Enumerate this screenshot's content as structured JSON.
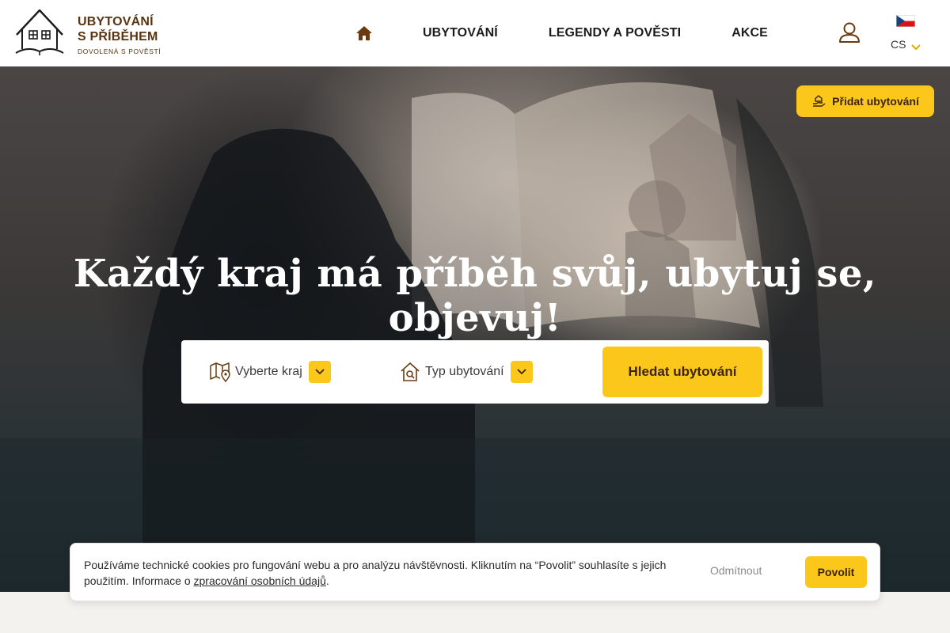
{
  "header": {
    "logo": {
      "line1": "UBYTOVÁNÍ",
      "line2": "S PŘÍBĚHEM",
      "tagline": "DOVOLENÁ S POVĚSTÍ",
      "icon": "house-logo-icon"
    },
    "nav": {
      "home_icon": "home-icon",
      "items": [
        {
          "label": "UBYTOVÁNÍ"
        },
        {
          "label": "LEGENDY A POVĚSTI"
        },
        {
          "label": "AKCE"
        }
      ]
    },
    "user_icon": "user-icon",
    "language": {
      "code": "CS",
      "flag": "czech-flag-icon"
    }
  },
  "hero": {
    "add_button": {
      "label": "Přidat ubytování",
      "icon": "add-accommodation-icon"
    },
    "headline": "Každý kraj má příběh svůj, ubytuj se, objevuj!",
    "search": {
      "region": {
        "label": "Vyberte kraj",
        "icon": "map-pin-icon"
      },
      "type": {
        "label": "Typ ubytování",
        "icon": "house-search-icon"
      },
      "submit_label": "Hledat ubytování"
    }
  },
  "cookie_bar": {
    "text_before": "Používáme technické cookies pro fungování webu a pro analýzu návštěvnosti. Kliknutím na “Povolit” souhlasíte s jejich použitím. Informace o ",
    "link": "zpracování osobních údajů",
    "text_after": ".",
    "reject_label": "Odmítnout",
    "accept_label": "Povolit"
  },
  "colors": {
    "accent": "#fcc71b",
    "brand_brown": "#5a3411",
    "text_dark": "#1c1c1c"
  }
}
